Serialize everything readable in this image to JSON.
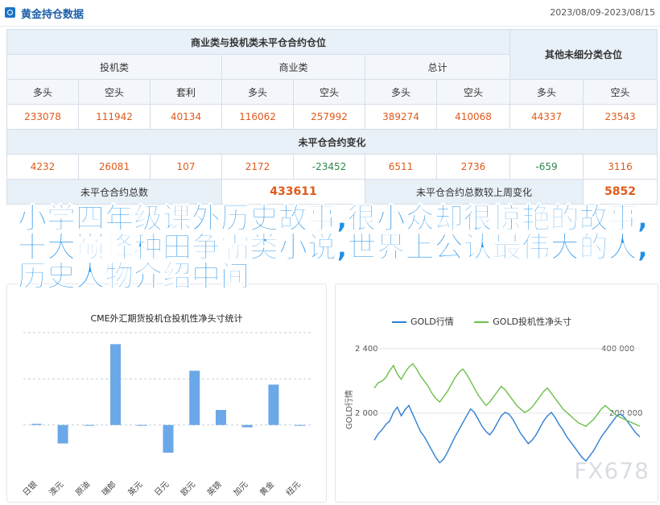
{
  "header": {
    "title": "黄金持仓数据",
    "date_range": "2023/08/09-2023/08/15"
  },
  "table": {
    "group_title": "商业类与投机类未平仓合约仓位",
    "other_title": "其他未细分类仓位",
    "sub_groups": [
      "投机类",
      "商业类",
      "总计"
    ],
    "long_label": "多头",
    "short_label": "空头",
    "spread_label": "套利",
    "values": [
      "233078",
      "111942",
      "40134",
      "116062",
      "257992",
      "389274",
      "410068",
      "44337",
      "23543"
    ],
    "change_title": "未平仓合约变化",
    "changes": [
      "4232",
      "26081",
      "107",
      "2172",
      "-23452",
      "6511",
      "2736",
      "-659",
      "3116"
    ],
    "total_label": "未平仓合约总数",
    "total_value": "433611",
    "weekly_change_label": "未平仓合约总数较上周变化",
    "weekly_change_value": "5852"
  },
  "overlay_text": "小学四年级课外历史故事,很小众却很惊艳的故事,十大巅峰种田争霸类小说,世界上公认最伟大的人,历史人物介绍中间",
  "charts": {
    "left_title": "CME外汇期货投机仓投机性净头寸统计",
    "right_legend": [
      "GOLD行情",
      "GOLD投机性净头寸"
    ],
    "right_ylabel": "GOLD行情",
    "right_yticks_left": [
      "2 400",
      "2 000"
    ],
    "right_yticks_right": [
      "400 000",
      "200 000"
    ],
    "watermark": "FX678",
    "colors": {
      "bar": "#6aa8e8",
      "price_line": "#2f7fd1",
      "position_line": "#6cc04a"
    }
  },
  "chart_data": [
    {
      "type": "bar",
      "title": "CME外汇期货投机仓投机性净头寸统计",
      "categories": [
        "日银",
        "澳元",
        "原油",
        "瑞郎",
        "英元",
        "日元",
        "欧元",
        "英镑",
        "加元",
        "黄金",
        "纽元"
      ],
      "values": [
        1,
        -16,
        0,
        70,
        0,
        -24,
        47,
        13,
        -2,
        35,
        0
      ],
      "ylim": [
        -40,
        80
      ]
    },
    {
      "type": "line",
      "series": [
        {
          "name": "GOLD行情",
          "values": [
            1960,
            1978,
            1990,
            2005,
            2015,
            2040,
            2055,
            2030,
            2048,
            2060,
            2035,
            2010,
            1985,
            1970,
            1950,
            1930,
            1910,
            1895,
            1905,
            1925,
            1948,
            1970,
            1990,
            2010,
            2030,
            2050,
            2040,
            2020,
            2000,
            1985,
            1975,
            1990,
            2010,
            2030,
            2040,
            2035,
            2020,
            2000,
            1980,
            1965,
            1950,
            1960,
            1975,
            1995,
            2015,
            2030,
            2040,
            2025,
            2005,
            1990,
            1970,
            1955,
            1940,
            1925,
            1910,
            1900,
            1915,
            1930,
            1950,
            1970,
            1985,
            2000,
            2015,
            2030,
            2035,
            2025,
            2010,
            1995,
            1980,
            1970
          ]
        },
        {
          "name": "GOLD投机性净头寸",
          "values": [
            2110,
            2125,
            2130,
            2140,
            2160,
            2175,
            2150,
            2135,
            2155,
            2170,
            2180,
            2165,
            2145,
            2130,
            2115,
            2095,
            2080,
            2070,
            2085,
            2100,
            2120,
            2140,
            2155,
            2165,
            2150,
            2130,
            2110,
            2090,
            2075,
            2060,
            2070,
            2085,
            2100,
            2115,
            2105,
            2090,
            2075,
            2060,
            2050,
            2040,
            2045,
            2055,
            2070,
            2085,
            2100,
            2110,
            2095,
            2080,
            2065,
            2050,
            2040,
            2030,
            2020,
            2010,
            2005,
            2000,
            2010,
            2020,
            2035,
            2050,
            2060,
            2050,
            2040,
            2030,
            2025,
            2020,
            2015,
            2010,
            2005,
            2000
          ]
        }
      ],
      "ylabel": "GOLD行情"
    }
  ]
}
